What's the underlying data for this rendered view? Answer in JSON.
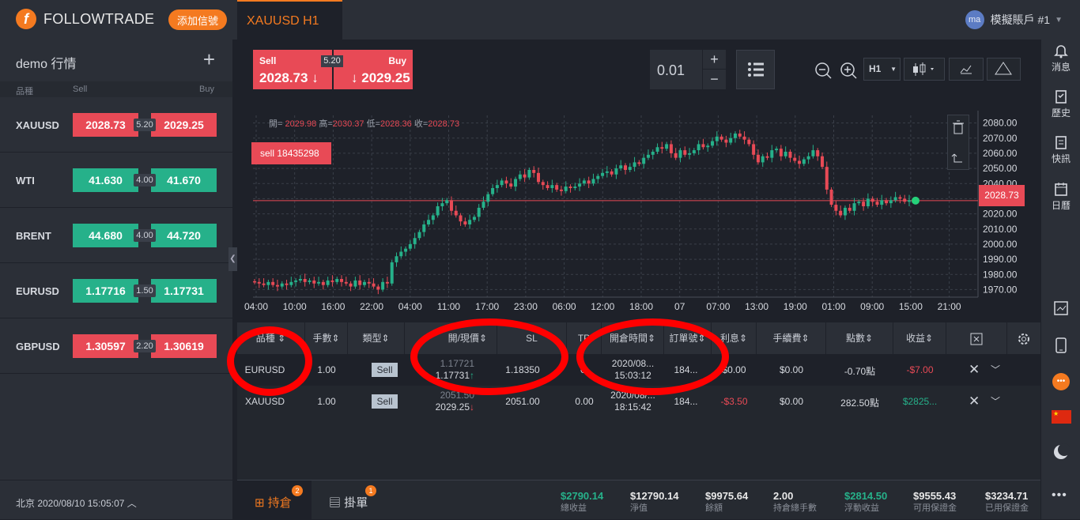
{
  "header": {
    "brand": "FOLLOWTRADE",
    "add_signal": "添加信號",
    "symbol_tab": "XAUUSD H1",
    "avatar_initials": "ma",
    "account": "模擬賬戶 #1"
  },
  "watchlist": {
    "title": "demo 行情",
    "col_symbol": "品種",
    "col_sell": "Sell",
    "col_buy": "Buy",
    "items": [
      {
        "symbol": "XAUUSD",
        "sell": "2028.73",
        "spread": "5.20",
        "buy": "2029.25",
        "color": "#e84a56"
      },
      {
        "symbol": "WTI",
        "sell": "41.630",
        "spread": "4.00",
        "buy": "41.670",
        "color": "#26b18a"
      },
      {
        "symbol": "BRENT",
        "sell": "44.680",
        "spread": "4.00",
        "buy": "44.720",
        "color": "#26b18a"
      },
      {
        "symbol": "EURUSD",
        "sell": "1.17716",
        "spread": "1.50",
        "buy": "1.17731",
        "color": "#26b18a"
      },
      {
        "symbol": "GBPUSD",
        "sell": "1.30597",
        "spread": "2.20",
        "buy": "1.30619",
        "color": "#e84a56"
      }
    ],
    "clock": "北京 2020/08/10 15:05:07"
  },
  "trade": {
    "sell_label": "Sell",
    "sell_price": "2028.73",
    "buy_label": "Buy",
    "buy_price": "2029.25",
    "spread": "5.20",
    "lot": "0.01",
    "timeframe": "H1"
  },
  "chart_data": {
    "type": "candlestick",
    "symbol": "XAUUSD",
    "ohlc_text": {
      "open_label": "開=",
      "open": "2029.98",
      "high_label": "高=",
      "high": "2030.37",
      "low_label": "低=",
      "low": "2028.36",
      "close_label": "收=",
      "close": "2028.73"
    },
    "order_tag": "sell 18435298",
    "current_price": "2028.73",
    "y_ticks": [
      "2080.00",
      "2070.00",
      "2060.00",
      "2050.00",
      "2040.00",
      "2030.00",
      "2020.00",
      "2010.00",
      "2000.00",
      "1990.00",
      "1980.00",
      "1970.00"
    ],
    "x_ticks": [
      "04:00",
      "10:00",
      "16:00",
      "22:00",
      "04:00",
      "11:00",
      "17:00",
      "23:00",
      "06:00",
      "12:00",
      "18:00",
      "07",
      "07:00",
      "13:00",
      "19:00",
      "01:00",
      "09:00",
      "15:00",
      "21:00"
    ],
    "ylim": [
      1965,
      2085
    ],
    "close_series": [
      1975,
      1974,
      1973,
      1975,
      1973,
      1972,
      1974,
      1973,
      1975,
      1976,
      1977,
      1975,
      1976,
      1974,
      1975,
      1973,
      1976,
      1975,
      1977,
      1975,
      1974,
      1972,
      1976,
      1973,
      1975,
      1974,
      1972,
      1970,
      1975,
      1974,
      1988,
      1992,
      1995,
      1997,
      2000,
      2004,
      2008,
      2013,
      2016,
      2019,
      2025,
      2027,
      2029,
      2022,
      2019,
      2015,
      2013,
      2016,
      2018,
      2024,
      2028,
      2033,
      2037,
      2039,
      2042,
      2040,
      2038,
      2043,
      2046,
      2044,
      2049,
      2047,
      2041,
      2039,
      2037,
      2039,
      2036,
      2035,
      2038,
      2037,
      2038,
      2040,
      2042,
      2040,
      2043,
      2045,
      2047,
      2048,
      2046,
      2050,
      2052,
      2049,
      2051,
      2054,
      2053,
      2057,
      2059,
      2061,
      2064,
      2063,
      2066,
      2060,
      2057,
      2062,
      2059,
      2060,
      2062,
      2066,
      2064,
      2065,
      2068,
      2071,
      2069,
      2067,
      2070,
      2073,
      2071,
      2069,
      2066,
      2059,
      2054,
      2058,
      2057,
      2062,
      2063,
      2058,
      2061,
      2057,
      2055,
      2053,
      2056,
      2058,
      2062,
      2058,
      2051,
      2036,
      2026,
      2022,
      2019,
      2024,
      2022,
      2027,
      2028,
      2025,
      2030,
      2028,
      2026,
      2029,
      2027,
      2029,
      2031,
      2030,
      2028,
      2029
    ]
  },
  "positions": {
    "columns": {
      "symbol": "品種",
      "lots": "手數",
      "type": "類型",
      "open_cur": "開/現價",
      "sl": "SL",
      "tp": "TP",
      "open_time": "開倉時間",
      "order": "訂單號",
      "interest": "利息",
      "fee": "手續費",
      "points": "點數",
      "profit": "收益"
    },
    "rows": [
      {
        "symbol": "EURUSD",
        "lots": "1.00",
        "type": "Sell",
        "open": "1.17721",
        "current": "1.17731",
        "dir": "↑",
        "sl": "1.18350",
        "tp": "0.",
        "date": "2020/08...",
        "time": "15:03:12",
        "order": "184...",
        "interest": "$0.00",
        "fee": "$0.00",
        "points": "-0.70點",
        "profit": "-$7.00"
      },
      {
        "symbol": "XAUUSD",
        "lots": "1.00",
        "type": "Sell",
        "open": "2051.50",
        "current": "2029.25",
        "dir": "↓",
        "sl": "2051.00",
        "tp": "0.00",
        "date": "2020/08/...",
        "time": "18:15:42",
        "order": "184...",
        "interest": "-$3.50",
        "fee": "$0.00",
        "points": "282.50點",
        "profit": "$2825..."
      }
    ]
  },
  "footer": {
    "tab_positions": "持倉",
    "positions_count": "2",
    "tab_pending": "掛單",
    "pending_count": "1",
    "stats": [
      {
        "value": "$2790.14",
        "label": "總收益"
      },
      {
        "value": "$12790.14",
        "label": "淨值"
      },
      {
        "value": "$9975.64",
        "label": "餘額"
      },
      {
        "value": "2.00",
        "label": "持倉總手數"
      },
      {
        "value": "$2814.50",
        "label": "浮動收益"
      },
      {
        "value": "$9555.43",
        "label": "可用保證金"
      },
      {
        "value": "$3234.71",
        "label": "已用保證金"
      }
    ]
  },
  "rail": {
    "messages": "消息",
    "history": "歷史",
    "news": "快訊",
    "calendar": "日曆"
  }
}
